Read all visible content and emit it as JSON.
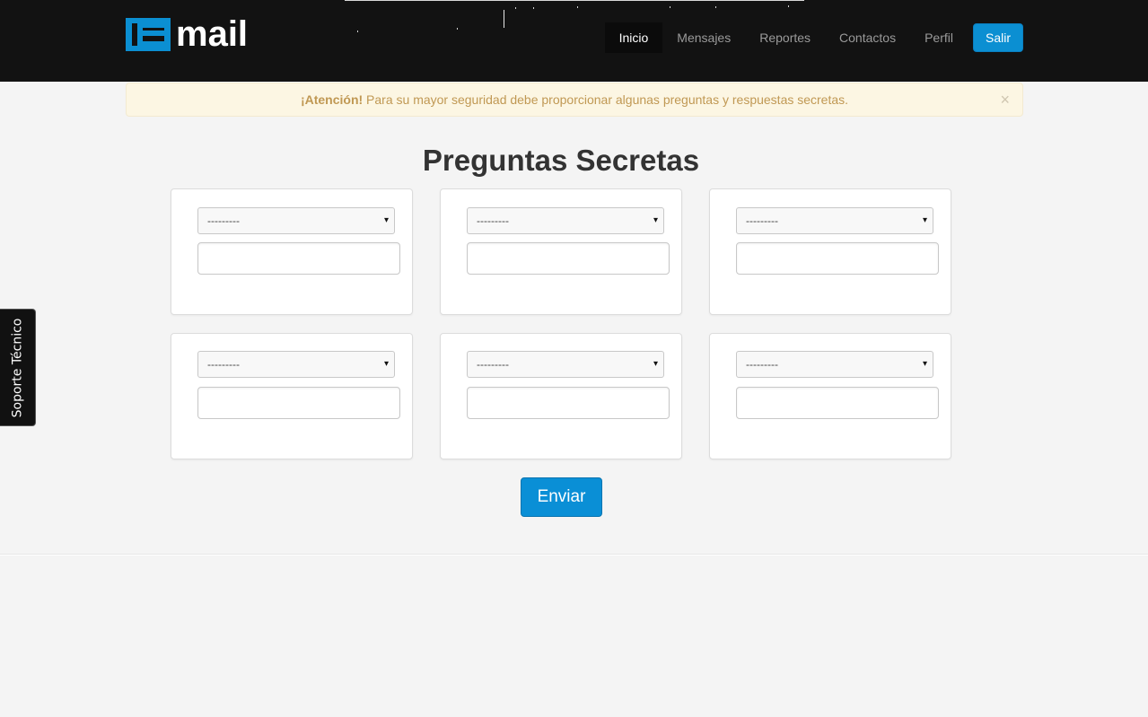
{
  "brand": {
    "logo_text": "mail",
    "accent": "#0b8fd2"
  },
  "nav": {
    "items": [
      "Inicio",
      "Mensajes",
      "Reportes",
      "Contactos",
      "Perfil"
    ],
    "active": "Inicio",
    "logout_label": "Salir"
  },
  "alert": {
    "strong": "¡Atención!",
    "text": " Para su mayor seguridad debe proporcionar algunas preguntas y respuestas secretas.",
    "close": "×",
    "background": "#fcf6e3",
    "text_color": "#c09853"
  },
  "page": {
    "title": "Preguntas Secretas"
  },
  "questions": [
    {
      "selected": "---------",
      "answer": ""
    },
    {
      "selected": "---------",
      "answer": ""
    },
    {
      "selected": "---------",
      "answer": ""
    },
    {
      "selected": "---------",
      "answer": ""
    },
    {
      "selected": "---------",
      "answer": ""
    },
    {
      "selected": "---------",
      "answer": ""
    }
  ],
  "submit_label": "Enviar",
  "support_tab": "Soporte Técnico",
  "icons": {
    "select_caret": "▾",
    "logo_mark": "logo-icon"
  }
}
